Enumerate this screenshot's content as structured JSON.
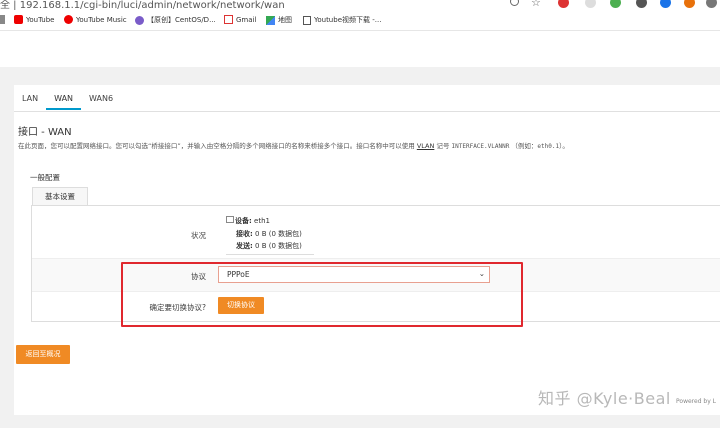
{
  "browser": {
    "url": "全 | 192.168.1.1/cgi-bin/luci/admin/network/network/wan",
    "bookmarks": [
      {
        "label": "YouTube",
        "icon": "youtube-icon"
      },
      {
        "label": "YouTube Music",
        "icon": "youtube-music-icon"
      },
      {
        "label": "【原创】CentOS/D...",
        "icon": "centos-bookmark-icon"
      },
      {
        "label": "Gmail",
        "icon": "gmail-icon"
      },
      {
        "label": "地图",
        "icon": "maps-icon"
      },
      {
        "label": "Youtube视频下载 -...",
        "icon": "page-icon"
      }
    ]
  },
  "tabs": [
    {
      "label": "LAN",
      "active": false
    },
    {
      "label": "WAN",
      "active": true
    },
    {
      "label": "WAN6",
      "active": false
    }
  ],
  "page": {
    "title": "接口 - WAN",
    "desc_part1": "在此页面，您可以配置网络接口。您可以勾选“桥接接口”，并输入由空格分隔的多个网络接口的名称来桥接多个接口。接口名称中可以使用",
    "desc_vlan": "VLAN",
    "desc_part2": "记号",
    "desc_code": "INTERFACE.VLANNR",
    "desc_part3": "（例如：",
    "desc_code2": "eth0.1",
    "desc_part4": "）。"
  },
  "section": {
    "title": "一般配置",
    "tab": "基本设置",
    "status_label": "状况",
    "status": {
      "device_label": "设备:",
      "device": "eth1",
      "rx_label": "接收:",
      "rx": "0 B (0 数据包)",
      "tx_label": "发送:",
      "tx": "0 B (0 数据包)"
    },
    "protocol_label": "协议",
    "protocol_value": "PPPoE",
    "confirm_label": "确定要切换协议?",
    "switch_button": "切换协议"
  },
  "back_button": "返回至概况",
  "watermark": "知乎 @Kyle·Beal",
  "footer": "Powered by L",
  "colors": {
    "accent": "#0099cc",
    "button": "#f08a24",
    "highlight": "#e0282e"
  }
}
